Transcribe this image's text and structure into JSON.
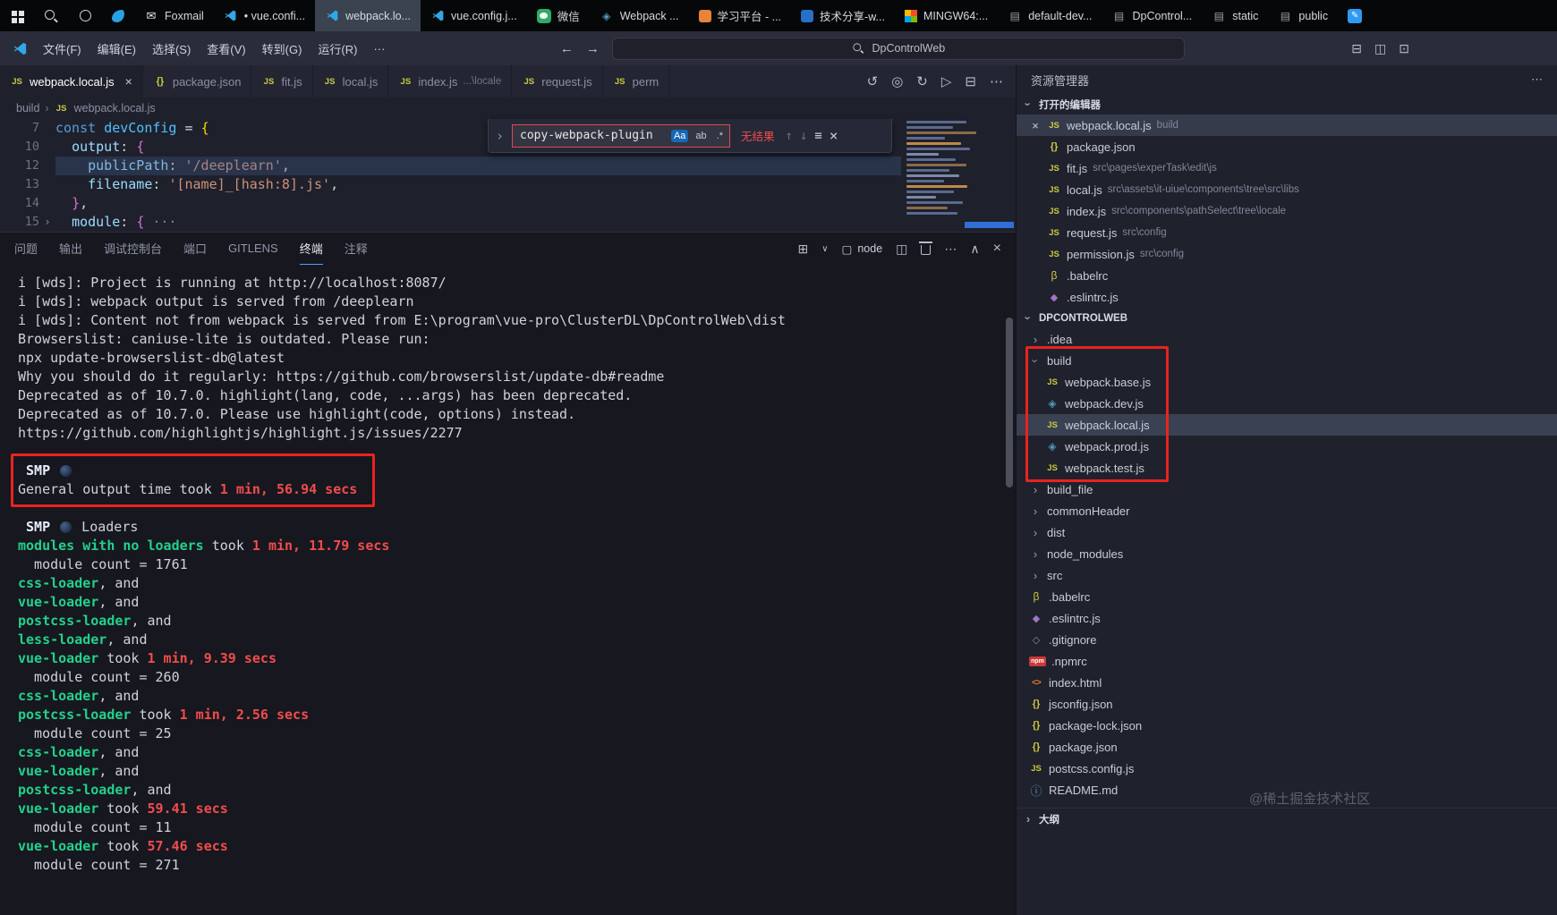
{
  "taskbar": {
    "items": [
      {
        "icon": "start-grid",
        "label": ""
      },
      {
        "icon": "search",
        "label": ""
      },
      {
        "icon": "circle",
        "label": ""
      },
      {
        "icon": "swoosh",
        "label": ""
      },
      {
        "icon": "foxmail",
        "label": "Foxmail"
      },
      {
        "icon": "vscode",
        "label": "• vue.confi..."
      },
      {
        "icon": "vscode",
        "label": "webpack.lo...",
        "active": true
      },
      {
        "icon": "vscode",
        "label": "vue.config.j..."
      },
      {
        "icon": "wechat",
        "label": "微信"
      },
      {
        "icon": "webpack",
        "label": "Webpack ..."
      },
      {
        "icon": "learn",
        "label": "学习平台 - ..."
      },
      {
        "icon": "share",
        "label": "技术分享-w..."
      },
      {
        "icon": "mingw",
        "label": "MINGW64:..."
      },
      {
        "icon": "file",
        "label": "default-dev..."
      },
      {
        "icon": "file",
        "label": "DpControl..."
      },
      {
        "icon": "file",
        "label": "static"
      },
      {
        "icon": "file",
        "label": "public"
      },
      {
        "icon": "editblue",
        "label": ""
      }
    ]
  },
  "titlebar": {
    "menus": [
      "文件(F)",
      "编辑(E)",
      "选择(S)",
      "查看(V)",
      "转到(G)",
      "运行(R)",
      "···"
    ],
    "search": "DpControlWeb"
  },
  "tabs": [
    {
      "icon": "js",
      "label": "webpack.local.js",
      "active": true,
      "close": true
    },
    {
      "icon": "json",
      "label": "package.json"
    },
    {
      "icon": "js",
      "label": "fit.js"
    },
    {
      "icon": "js",
      "label": "local.js"
    },
    {
      "icon": "js",
      "label": "index.js",
      "desc": "...\\locale"
    },
    {
      "icon": "js",
      "label": "request.js"
    },
    {
      "icon": "js",
      "label": "perm"
    }
  ],
  "breadcrumb": {
    "items": [
      "build",
      "webpack.local.js"
    ]
  },
  "editor": {
    "lines": [
      {
        "num": "7",
        "segs": [
          [
            "kw",
            "const"
          ],
          [
            "d",
            " "
          ],
          [
            "var",
            "devConfig"
          ],
          [
            "d",
            " = "
          ],
          [
            "b1",
            "{"
          ]
        ]
      },
      {
        "num": "10",
        "segs": [
          [
            "d",
            "  "
          ],
          [
            "prop",
            "output"
          ],
          [
            "d",
            ": "
          ],
          [
            "b2",
            "{"
          ]
        ]
      },
      {
        "num": "12",
        "selected": true,
        "segs": [
          [
            "d",
            "    "
          ],
          [
            "prop",
            "publicPath"
          ],
          [
            "d",
            ": "
          ],
          [
            "str",
            "'/deeplearn'"
          ],
          [
            "d",
            ","
          ]
        ]
      },
      {
        "num": "13",
        "segs": [
          [
            "d",
            "    "
          ],
          [
            "prop",
            "filename"
          ],
          [
            "d",
            ": "
          ],
          [
            "str",
            "'[name]_[hash:8].js'"
          ],
          [
            "d",
            ","
          ]
        ]
      },
      {
        "num": "14",
        "segs": [
          [
            "d",
            "  "
          ],
          [
            "b2",
            "}"
          ],
          [
            "d",
            ","
          ]
        ]
      },
      {
        "num": "15",
        "fold": true,
        "segs": [
          [
            "d",
            "  "
          ],
          [
            "prop",
            "module"
          ],
          [
            "d",
            ": "
          ],
          [
            "b2",
            "{"
          ],
          [
            "dim",
            " ···"
          ]
        ]
      }
    ]
  },
  "find": {
    "value": "copy-webpack-plugin",
    "options": [
      "Aa",
      "ab",
      ".*"
    ],
    "status": "无结果"
  },
  "panel": {
    "tabs": [
      "问题",
      "输出",
      "调试控制台",
      "端口",
      "GITLENS",
      "终端",
      "注释"
    ],
    "active": "终端",
    "shell": "node"
  },
  "terminal": {
    "lines": [
      [
        [
          "d",
          "i [wds]: Project is running at http://localhost:8087/"
        ]
      ],
      [
        [
          "d",
          "i [wds]: webpack output is served from /deeplearn"
        ]
      ],
      [
        [
          "d",
          "i [wds]: Content not from webpack is served from E:\\program\\vue-pro\\ClusterDL\\DpControlWeb\\dist"
        ]
      ],
      [
        [
          "d",
          "Browserslist: caniuse-lite is outdated. Please run:"
        ]
      ],
      [
        [
          "d",
          "npx update-browserslist-db@latest"
        ]
      ],
      [
        [
          "d",
          "Why you should do it regularly: https://github.com/browserslist/update-db#readme"
        ]
      ],
      [
        [
          "d",
          "Deprecated as of 10.7.0. highlight(lang, code, ...args) has been deprecated."
        ]
      ],
      [
        [
          "d",
          "Deprecated as of 10.7.0. Please use highlight(code, options) instead."
        ]
      ],
      [
        [
          "d",
          "https://github.com/highlightjs/highlight.js/issues/2277"
        ]
      ],
      [],
      [
        [
          "smp",
          " SMP "
        ],
        [
          "clock",
          ""
        ]
      ],
      [
        [
          "d",
          "General output time took "
        ],
        [
          "r",
          "1 min, 56.94 secs"
        ]
      ],
      [],
      [
        [
          "smp",
          " SMP "
        ],
        [
          "clock",
          ""
        ],
        [
          "d",
          " Loaders"
        ]
      ],
      [
        [
          "g",
          "modules with no loaders"
        ],
        [
          "d",
          " took "
        ],
        [
          "r",
          "1 min, 11.79 secs"
        ]
      ],
      [
        [
          "d",
          "  module count = 1761"
        ]
      ],
      [
        [
          "g",
          "css-loader"
        ],
        [
          "d",
          ", and"
        ]
      ],
      [
        [
          "g",
          "vue-loader"
        ],
        [
          "d",
          ", and"
        ]
      ],
      [
        [
          "g",
          "postcss-loader"
        ],
        [
          "d",
          ", and"
        ]
      ],
      [
        [
          "g",
          "less-loader"
        ],
        [
          "d",
          ", and"
        ]
      ],
      [
        [
          "g",
          "vue-loader"
        ],
        [
          "d",
          " took "
        ],
        [
          "r",
          "1 min, 9.39 secs"
        ]
      ],
      [
        [
          "d",
          "  module count = 260"
        ]
      ],
      [
        [
          "g",
          "css-loader"
        ],
        [
          "d",
          ", and"
        ]
      ],
      [
        [
          "g",
          "postcss-loader"
        ],
        [
          "d",
          " took "
        ],
        [
          "r",
          "1 min, 2.56 secs"
        ]
      ],
      [
        [
          "d",
          "  module count = 25"
        ]
      ],
      [
        [
          "g",
          "css-loader"
        ],
        [
          "d",
          ", and"
        ]
      ],
      [
        [
          "g",
          "vue-loader"
        ],
        [
          "d",
          ", and"
        ]
      ],
      [
        [
          "g",
          "postcss-loader"
        ],
        [
          "d",
          ", and"
        ]
      ],
      [
        [
          "g",
          "vue-loader"
        ],
        [
          "d",
          " took "
        ],
        [
          "r",
          "59.41 secs"
        ]
      ],
      [
        [
          "d",
          "  module count = 11"
        ]
      ],
      [
        [
          "g",
          "vue-loader"
        ],
        [
          "d",
          " took "
        ],
        [
          "r",
          "57.46 secs"
        ]
      ],
      [
        [
          "d",
          "  module count = 271"
        ]
      ]
    ]
  },
  "sidebar": {
    "title": "资源管理器",
    "open_editors_label": "打开的编辑器",
    "open_editors": [
      {
        "icon": "js",
        "name": "webpack.local.js",
        "desc": "build",
        "active": true,
        "close": true
      },
      {
        "icon": "json",
        "name": "package.json"
      },
      {
        "icon": "js",
        "name": "fit.js",
        "desc": "src\\pages\\experTask\\edit\\js"
      },
      {
        "icon": "js",
        "name": "local.js",
        "desc": "src\\assets\\it-uiue\\components\\tree\\src\\libs"
      },
      {
        "icon": "js",
        "name": "index.js",
        "desc": "src\\components\\pathSelect\\tree\\locale"
      },
      {
        "icon": "js",
        "name": "request.js",
        "desc": "src\\config"
      },
      {
        "icon": "js",
        "name": "permission.js",
        "desc": "src\\config"
      },
      {
        "icon": "babel",
        "name": ".babelrc"
      },
      {
        "icon": "eslint",
        "name": ".eslintrc.js"
      }
    ],
    "workspace_label": "DPCONTROLWEB",
    "tree": [
      {
        "type": "folder",
        "name": ".idea",
        "open": false
      },
      {
        "type": "folder",
        "name": "build",
        "open": true
      },
      {
        "type": "file",
        "icon": "js",
        "name": "webpack.base.js",
        "child": true
      },
      {
        "type": "file",
        "icon": "webpack",
        "name": "webpack.dev.js",
        "child": true
      },
      {
        "type": "file",
        "icon": "js",
        "name": "webpack.local.js",
        "child": true,
        "selected": true
      },
      {
        "type": "file",
        "icon": "webpack",
        "name": "webpack.prod.js",
        "child": true
      },
      {
        "type": "file",
        "icon": "js",
        "name": "webpack.test.js",
        "child": true
      },
      {
        "type": "folder",
        "name": "build_file",
        "open": false
      },
      {
        "type": "folder",
        "name": "commonHeader",
        "open": false
      },
      {
        "type": "folder",
        "name": "dist",
        "open": false
      },
      {
        "type": "folder",
        "name": "node_modules",
        "open": false
      },
      {
        "type": "folder",
        "name": "src",
        "open": false
      },
      {
        "type": "file",
        "icon": "babel",
        "name": ".babelrc"
      },
      {
        "type": "file",
        "icon": "eslint",
        "name": ".eslintrc.js"
      },
      {
        "type": "file",
        "icon": "git",
        "name": ".gitignore"
      },
      {
        "type": "file",
        "icon": "npm",
        "name": ".npmrc"
      },
      {
        "type": "file",
        "icon": "html",
        "name": "index.html"
      },
      {
        "type": "file",
        "icon": "json",
        "name": "jsconfig.json"
      },
      {
        "type": "file",
        "icon": "json",
        "name": "package-lock.json"
      },
      {
        "type": "file",
        "icon": "json",
        "name": "package.json"
      },
      {
        "type": "file",
        "icon": "js",
        "name": "postcss.config.js"
      },
      {
        "type": "file",
        "icon": "readme",
        "name": "README.md"
      }
    ],
    "outline_label": "大纲"
  },
  "watermark": "@稀土掘金技术社区"
}
